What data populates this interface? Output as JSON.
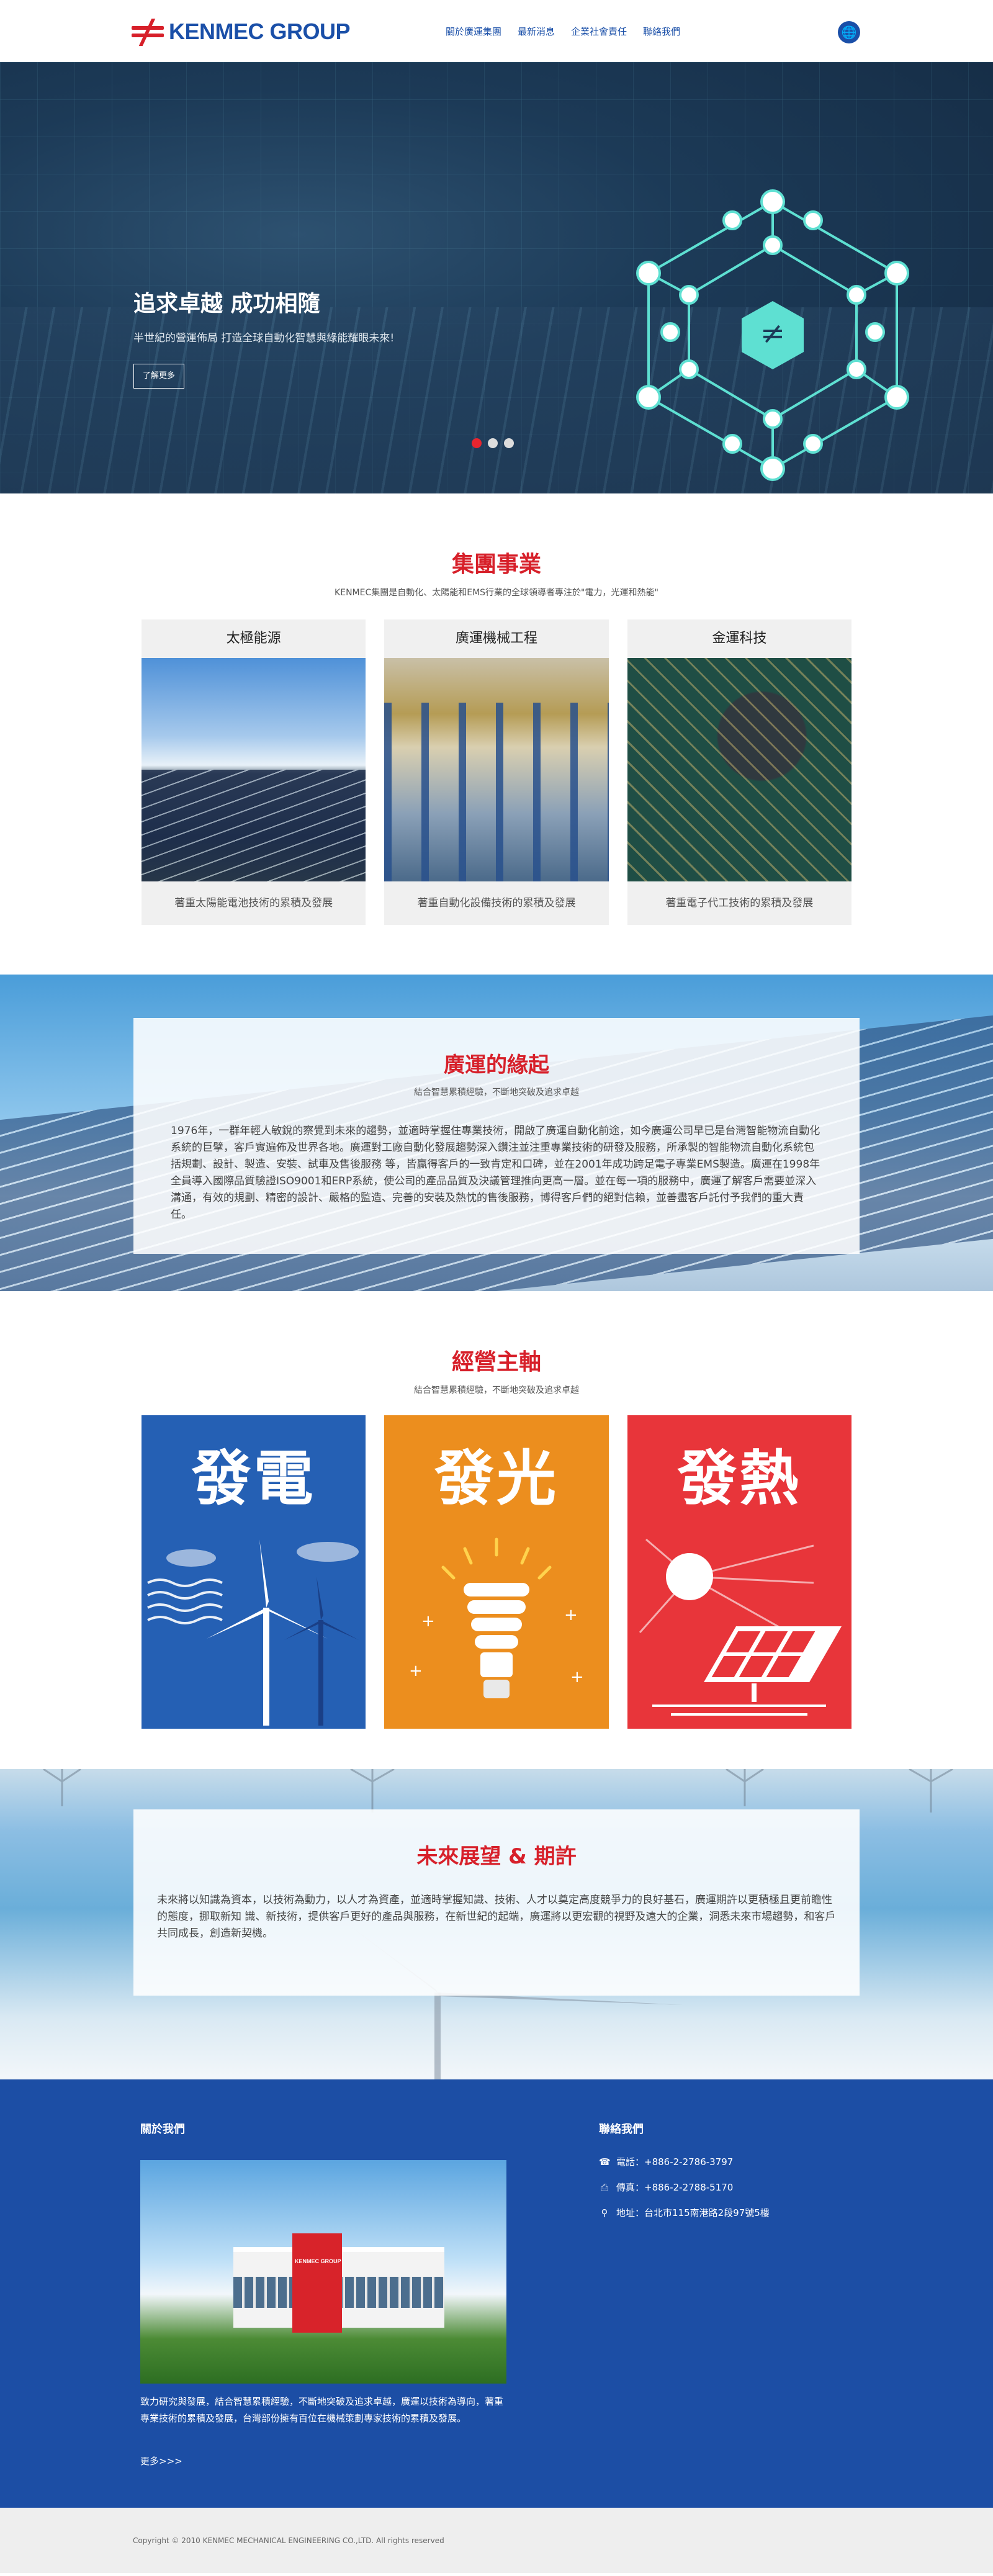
{
  "header": {
    "logo_text": "KENMEC GROUP",
    "nav": [
      "關於廣運集團",
      "最新消息",
      "企業社會責任",
      "聯絡我們"
    ],
    "lang_icon": "globe-icon"
  },
  "hero": {
    "title": "追求卓越 成功相隨",
    "subtitle": "半世紀的營運佈局 打造全球自動化智慧與綠能耀眼未來!",
    "button": "了解更多",
    "slides": 3,
    "active_slide": 1
  },
  "business": {
    "title": "集團事業",
    "subtitle": "KENMEC集團是自動化、太陽能和EMS行業的全球領導者專注於\"電力，光運和熱能\"",
    "cards": [
      {
        "title": "太極能源",
        "caption": "著重太陽能電池技術的累積及發展"
      },
      {
        "title": "廣運機械工程",
        "caption": "著重自動化設備技術的累積及發展"
      },
      {
        "title": "金運科技",
        "caption": "著重電子代工技術的累積及發展"
      }
    ]
  },
  "origin": {
    "title": "廣運的緣起",
    "subtitle": "結合智慧累積經驗，不斷地突破及追求卓越",
    "text": "1976年，一群年輕人敏銳的察覺到未來的趨勢，並適時掌握住專業技術，開啟了廣運自動化前途，如今廣運公司早已是台灣智能物流自動化系統的巨擘，客戶實遍佈及世界各地。廣運對工廠自動化發展趨勢深入鑽注並注重專業技術的研發及服務，所承製的智能物流自動化系統包括規劃、設計、製造、安裝、試車及售後服務 等，皆贏得客戶的一致肯定和口碑，並在2001年成功跨足電子專業EMS製造。廣運在1998年全員導入國際品質驗證ISO9001和ERP系統，使公司的產品品質及決議管理推向更高一層。並在每一項的服務中，廣運了解客戶需要並深入溝通，有效的規劃、精密的設計、嚴格的監造、完善的安裝及熱忱的售後服務，博得客戶們的絕對信賴，並善盡客戶託付予我們的重大責任。"
  },
  "axis": {
    "title": "經營主軸",
    "subtitle": "結合智慧累積經驗，不斷地突破及追求卓越",
    "items": [
      {
        "word": "發電",
        "icon": "wind-turbine-icon",
        "color": "#2560b4"
      },
      {
        "word": "發光",
        "icon": "light-bulb-icon",
        "color": "#ec8e1e"
      },
      {
        "word": "發熱",
        "icon": "sun-solar-panel-icon",
        "color": "#e8353a"
      }
    ]
  },
  "future": {
    "title": "未來展望 & 期許",
    "text": "未來將以知識為資本，以技術為動力，以人才為資產，並適時掌握知識、技術、人才以奠定高度競爭力的良好基石，廣運期許以更積極且更前瞻性的態度，挪取新知 識、新技術，提供客戶更好的產品與服務，在新世紀的起端，廣運將以更宏觀的視野及遠大的企業，洞悉未來市場趨勢，和客戶共同成長，創造新契機。"
  },
  "footer": {
    "about_title": "關於我們",
    "about_text": "致力研究與發展，結合智慧累積經驗，不斷地突破及追求卓越，廣運以技術為導向，著重專業技術的累積及發展，台灣部份擁有百位在機械策劃專家技術的累積及發展。",
    "more": "更多>>>",
    "contact_title": "聯絡我們",
    "phone": "電話：+886-2-2786-3797",
    "fax": "傳真：+886-2-2788-5170",
    "address": "地址：台北市115南港路2段97號5樓",
    "photo_sign": "KENMEC GROUP"
  },
  "copyright": "Copyright © 2010 KENMEC MECHANICAL ENGINEERING CO.,LTD. All rights reserved"
}
